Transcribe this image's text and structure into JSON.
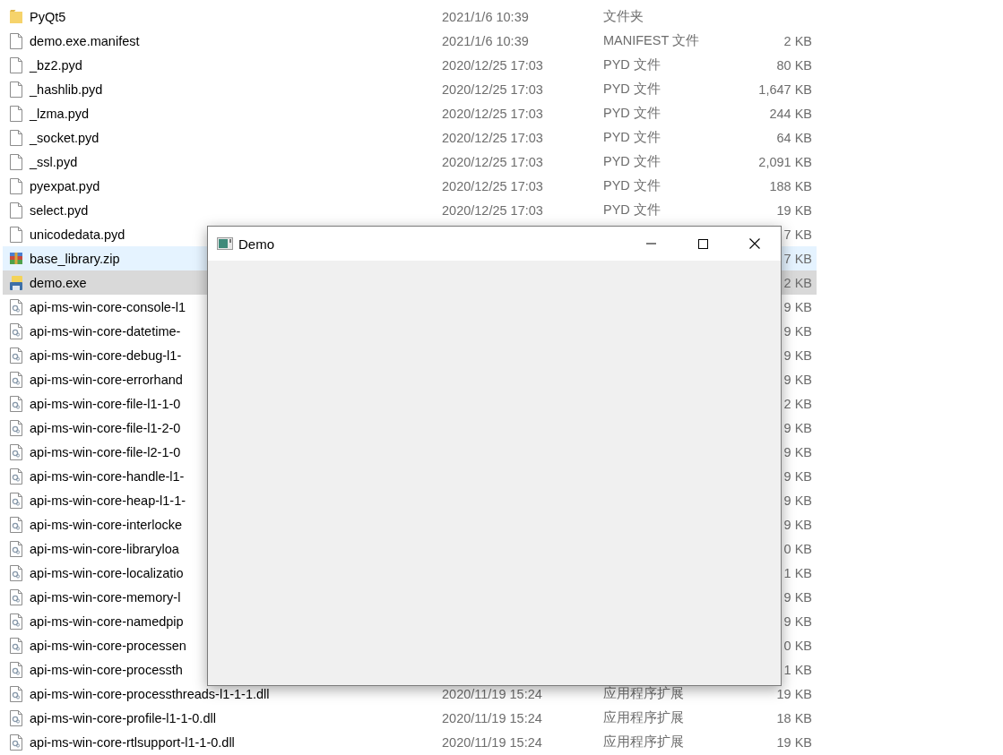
{
  "files": [
    {
      "kind": "folder",
      "name": "PyQt5",
      "date": "2021/1/6 10:39",
      "type": "文件夹",
      "selected": false,
      "hovered": false
    },
    {
      "kind": "file",
      "name": "demo.exe.manifest",
      "date": "2021/1/6 10:39",
      "type": "MANIFEST 文件",
      "size": "2 KB",
      "selected": false,
      "hovered": false
    },
    {
      "kind": "file",
      "name": "_bz2.pyd",
      "date": "2020/12/25 17:03",
      "type": "PYD 文件",
      "size": "80 KB",
      "selected": false,
      "hovered": false
    },
    {
      "kind": "file",
      "name": "_hashlib.pyd",
      "date": "2020/12/25 17:03",
      "type": "PYD 文件",
      "size": "1,647 KB",
      "selected": false,
      "hovered": false
    },
    {
      "kind": "file",
      "name": "_lzma.pyd",
      "date": "2020/12/25 17:03",
      "type": "PYD 文件",
      "size": "244 KB",
      "selected": false,
      "hovered": false
    },
    {
      "kind": "file",
      "name": "_socket.pyd",
      "date": "2020/12/25 17:03",
      "type": "PYD 文件",
      "size": "64 KB",
      "selected": false,
      "hovered": false
    },
    {
      "kind": "file",
      "name": "_ssl.pyd",
      "date": "2020/12/25 17:03",
      "type": "PYD 文件",
      "size": "2,091 KB",
      "selected": false,
      "hovered": false
    },
    {
      "kind": "file",
      "name": "pyexpat.pyd",
      "date": "2020/12/25 17:03",
      "type": "PYD 文件",
      "size": "188 KB",
      "selected": false,
      "hovered": false
    },
    {
      "kind": "file",
      "name": "select.pyd",
      "date": "2020/12/25 17:03",
      "type": "PYD 文件",
      "size": "19 KB",
      "selected": false,
      "hovered": false
    },
    {
      "kind": "file",
      "name": "unicodedata.pyd",
      "size": "7 KB",
      "selected": false,
      "hovered": false
    },
    {
      "kind": "archive",
      "name": "base_library.zip",
      "size": "7 KB",
      "selected": false,
      "hovered": true
    },
    {
      "kind": "exe",
      "name": "demo.exe",
      "size": "2 KB",
      "selected": true,
      "hovered": false
    },
    {
      "kind": "dll",
      "name": "api-ms-win-core-console-l1",
      "size": "9 KB",
      "selected": false,
      "hovered": false
    },
    {
      "kind": "dll",
      "name": "api-ms-win-core-datetime-",
      "size": "9 KB",
      "selected": false,
      "hovered": false
    },
    {
      "kind": "dll",
      "name": "api-ms-win-core-debug-l1-",
      "size": "9 KB",
      "selected": false,
      "hovered": false
    },
    {
      "kind": "dll",
      "name": "api-ms-win-core-errorhand",
      "size": "9 KB",
      "selected": false,
      "hovered": false
    },
    {
      "kind": "dll",
      "name": "api-ms-win-core-file-l1-1-0",
      "size": "2 KB",
      "selected": false,
      "hovered": false
    },
    {
      "kind": "dll",
      "name": "api-ms-win-core-file-l1-2-0",
      "size": "9 KB",
      "selected": false,
      "hovered": false
    },
    {
      "kind": "dll",
      "name": "api-ms-win-core-file-l2-1-0",
      "size": "9 KB",
      "selected": false,
      "hovered": false
    },
    {
      "kind": "dll",
      "name": "api-ms-win-core-handle-l1-",
      "size": "9 KB",
      "selected": false,
      "hovered": false
    },
    {
      "kind": "dll",
      "name": "api-ms-win-core-heap-l1-1-",
      "size": "9 KB",
      "selected": false,
      "hovered": false
    },
    {
      "kind": "dll",
      "name": "api-ms-win-core-interlocke",
      "size": "9 KB",
      "selected": false,
      "hovered": false
    },
    {
      "kind": "dll",
      "name": "api-ms-win-core-libraryloa",
      "size": "0 KB",
      "selected": false,
      "hovered": false
    },
    {
      "kind": "dll",
      "name": "api-ms-win-core-localizatio",
      "size": "1 KB",
      "selected": false,
      "hovered": false
    },
    {
      "kind": "dll",
      "name": "api-ms-win-core-memory-l",
      "size": "9 KB",
      "selected": false,
      "hovered": false
    },
    {
      "kind": "dll",
      "name": "api-ms-win-core-namedpip",
      "size": "9 KB",
      "selected": false,
      "hovered": false
    },
    {
      "kind": "dll",
      "name": "api-ms-win-core-processen",
      "size": "0 KB",
      "selected": false,
      "hovered": false
    },
    {
      "kind": "dll",
      "name": "api-ms-win-core-processth",
      "size": "1 KB",
      "selected": false,
      "hovered": false
    },
    {
      "kind": "dll",
      "name": "api-ms-win-core-processthreads-l1-1-1.dll",
      "date": "2020/11/19 15:24",
      "type": "应用程序扩展",
      "size": "19 KB",
      "selected": false,
      "hovered": false
    },
    {
      "kind": "dll",
      "name": "api-ms-win-core-profile-l1-1-0.dll",
      "date": "2020/11/19 15:24",
      "type": "应用程序扩展",
      "size": "18 KB",
      "selected": false,
      "hovered": false
    },
    {
      "kind": "dll",
      "name": "api-ms-win-core-rtlsupport-l1-1-0.dll",
      "date": "2020/11/19 15:24",
      "type": "应用程序扩展",
      "size": "19 KB",
      "selected": false,
      "hovered": false
    }
  ],
  "window": {
    "title": "Demo"
  }
}
